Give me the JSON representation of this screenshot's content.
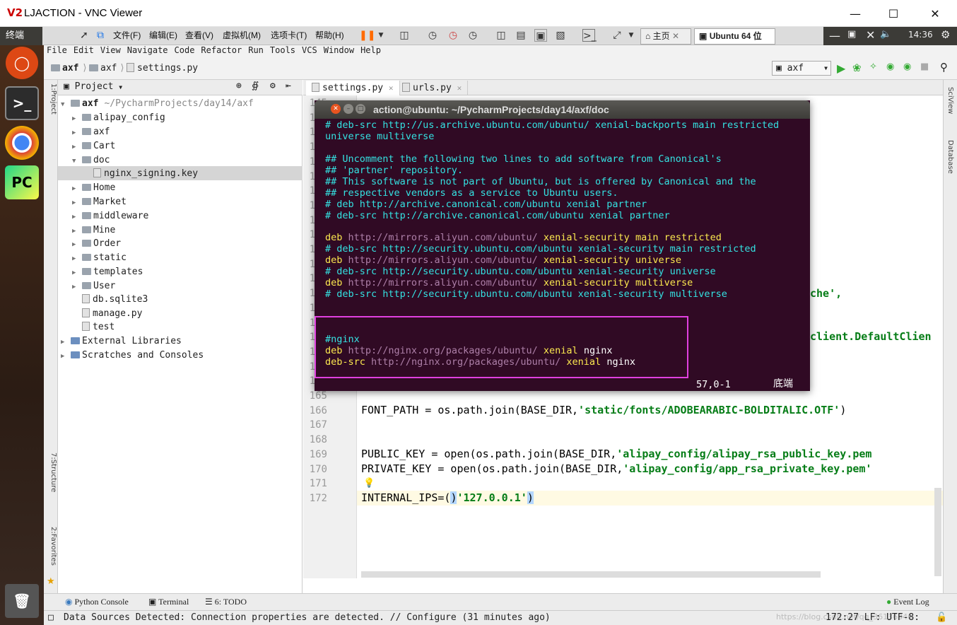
{
  "window": {
    "title": "LJACTION - VNC Viewer",
    "logo": "V2",
    "controls": [
      "minimize-icon",
      "maximize-icon",
      "close-icon"
    ]
  },
  "vmware": {
    "term_label": "终端",
    "menus": [
      "文件(F)",
      "编辑(E)",
      "查看(V)",
      "虚拟机(M)",
      "选项卡(T)",
      "帮助(H)"
    ],
    "tabs": [
      {
        "label": "主页"
      },
      {
        "label": "Ubuntu 64 位"
      }
    ],
    "clock": "14:36"
  },
  "pycharm": {
    "menu": [
      "File",
      "Edit",
      "View",
      "Navigate",
      "Code",
      "Refactor",
      "Run",
      "Tools",
      "VCS",
      "Window",
      "Help"
    ],
    "breadcrumb": [
      "axf",
      "axf",
      "settings.py"
    ],
    "run_config": "axf",
    "project_header": "Project",
    "tree": [
      {
        "label": "axf",
        "extra": "~/PycharmProjects/day14/axf",
        "level": 0,
        "type": "folder",
        "open": true
      },
      {
        "label": "alipay_config",
        "level": 1,
        "type": "folder"
      },
      {
        "label": "axf",
        "level": 1,
        "type": "folder"
      },
      {
        "label": "Cart",
        "level": 1,
        "type": "folder"
      },
      {
        "label": "doc",
        "level": 1,
        "type": "folder",
        "open": true
      },
      {
        "label": "nginx_signing.key",
        "level": 2,
        "type": "file",
        "selected": true
      },
      {
        "label": "Home",
        "level": 1,
        "type": "folder"
      },
      {
        "label": "Market",
        "level": 1,
        "type": "folder"
      },
      {
        "label": "middleware",
        "level": 1,
        "type": "folder"
      },
      {
        "label": "Mine",
        "level": 1,
        "type": "folder"
      },
      {
        "label": "Order",
        "level": 1,
        "type": "folder"
      },
      {
        "label": "static",
        "level": 1,
        "type": "folder"
      },
      {
        "label": "templates",
        "level": 1,
        "type": "folder"
      },
      {
        "label": "User",
        "level": 1,
        "type": "folder"
      },
      {
        "label": "db.sqlite3",
        "level": 1,
        "type": "file"
      },
      {
        "label": "manage.py",
        "level": 1,
        "type": "file"
      },
      {
        "label": "test",
        "level": 1,
        "type": "file"
      },
      {
        "label": "External Libraries",
        "level": 0,
        "type": "lib"
      },
      {
        "label": "Scratches and Consoles",
        "level": 0,
        "type": "lib"
      }
    ],
    "editor_tabs": [
      "settings.py",
      "urls.py"
    ],
    "line_numbers": [
      "145",
      "146",
      "147",
      "148",
      "149",
      "150",
      "151",
      "152",
      "153",
      "154",
      "155",
      "156",
      "157",
      "158",
      "159",
      "160",
      "161",
      "162",
      "163",
      "164",
      "165",
      "166",
      "167",
      "168",
      "169",
      "170",
      "171",
      "172"
    ],
    "code_behind": {
      "l158": "che',",
      "l161": "client.DefaultClien",
      "l166a": "FONT_PATH = os.path.join(BASE_DIR,",
      "l166b": "'static/fonts/ADOBEARABIC-BOLDITALIC.OTF'",
      "l166c": ")",
      "l169a": "PUBLIC_KEY = open(os.path.join(BASE_DIR,",
      "l169b": "'alipay_config/alipay_rsa_public_key.pem",
      "l170a": "PRIVATE_KEY = open(os.path.join(BASE_DIR,",
      "l170b": "'alipay_config/app_rsa_private_key.pem'",
      "l172a": "INTERNAL_IPS=(",
      "l172b": "'127.0.0.1'",
      "l172c": ")"
    },
    "bottom_tools": [
      "Python Console",
      "Terminal",
      "6: TODO"
    ],
    "event_log": "Event Log",
    "status_text": "Data Sources Detected: Connection properties are detected. // Configure (31 minutes ago)",
    "status_right": "172:27  LF:  UTF-8:",
    "watermark": "https://blog.csdn.net/qq_36136346"
  },
  "terminal": {
    "title": "action@ubuntu: ~/PycharmProjects/day14/axf/doc",
    "lines": [
      {
        "t": "# deb-src http://us.archive.ubuntu.com/ubuntu/ xenial-backports main restricted",
        "c": "cy"
      },
      {
        "t": "universe multiverse",
        "c": "cy"
      },
      {
        "t": "",
        "c": "cy"
      },
      {
        "t": "## Uncomment the following two lines to add software from Canonical's",
        "c": "cy"
      },
      {
        "t": "## 'partner' repository.",
        "c": "cy"
      },
      {
        "t": "## This software is not part of Ubuntu, but is offered by Canonical and the",
        "c": "cy"
      },
      {
        "t": "## respective vendors as a service to Ubuntu users.",
        "c": "cy"
      },
      {
        "t": "# deb http://archive.canonical.com/ubuntu xenial partner",
        "c": "cy"
      },
      {
        "t": "# deb-src http://archive.canonical.com/ubuntu xenial partner",
        "c": "cy"
      },
      {
        "t": "",
        "c": "cy"
      }
    ],
    "deb1": {
      "a": "deb",
      "b": "http://mirrors.aliyun.com/ubuntu/",
      "c": "xenial-security",
      "d": "main restricted"
    },
    "src1": "# deb-src http://security.ubuntu.com/ubuntu xenial-security main restricted",
    "deb2": {
      "a": "deb",
      "b": "http://mirrors.aliyun.com/ubuntu/",
      "c": "xenial-security",
      "d": "universe"
    },
    "src2": "# deb-src http://security.ubuntu.com/ubuntu xenial-security universe",
    "deb3": {
      "a": "deb",
      "b": "http://mirrors.aliyun.com/ubuntu/",
      "c": "xenial-security",
      "d": "multiverse"
    },
    "src3": "# deb-src http://security.ubuntu.com/ubuntu xenial-security multiverse",
    "nginx_comment": "#nginx",
    "nginx1": {
      "a": "deb",
      "b": "http://nginx.org/packages/ubuntu/",
      "c": "xenial",
      "d": "nginx"
    },
    "nginx2": {
      "a": "deb-src",
      "b": "http://nginx.org/packages/ubuntu/",
      "c": "xenial",
      "d": "nginx"
    },
    "cursor_pos": "57,0-1",
    "scroll_pos": "底端"
  },
  "colors": {
    "terminal_bg": "#300a24",
    "highlight_box": "#e040e0",
    "launcher_bg": "#3c2418"
  }
}
